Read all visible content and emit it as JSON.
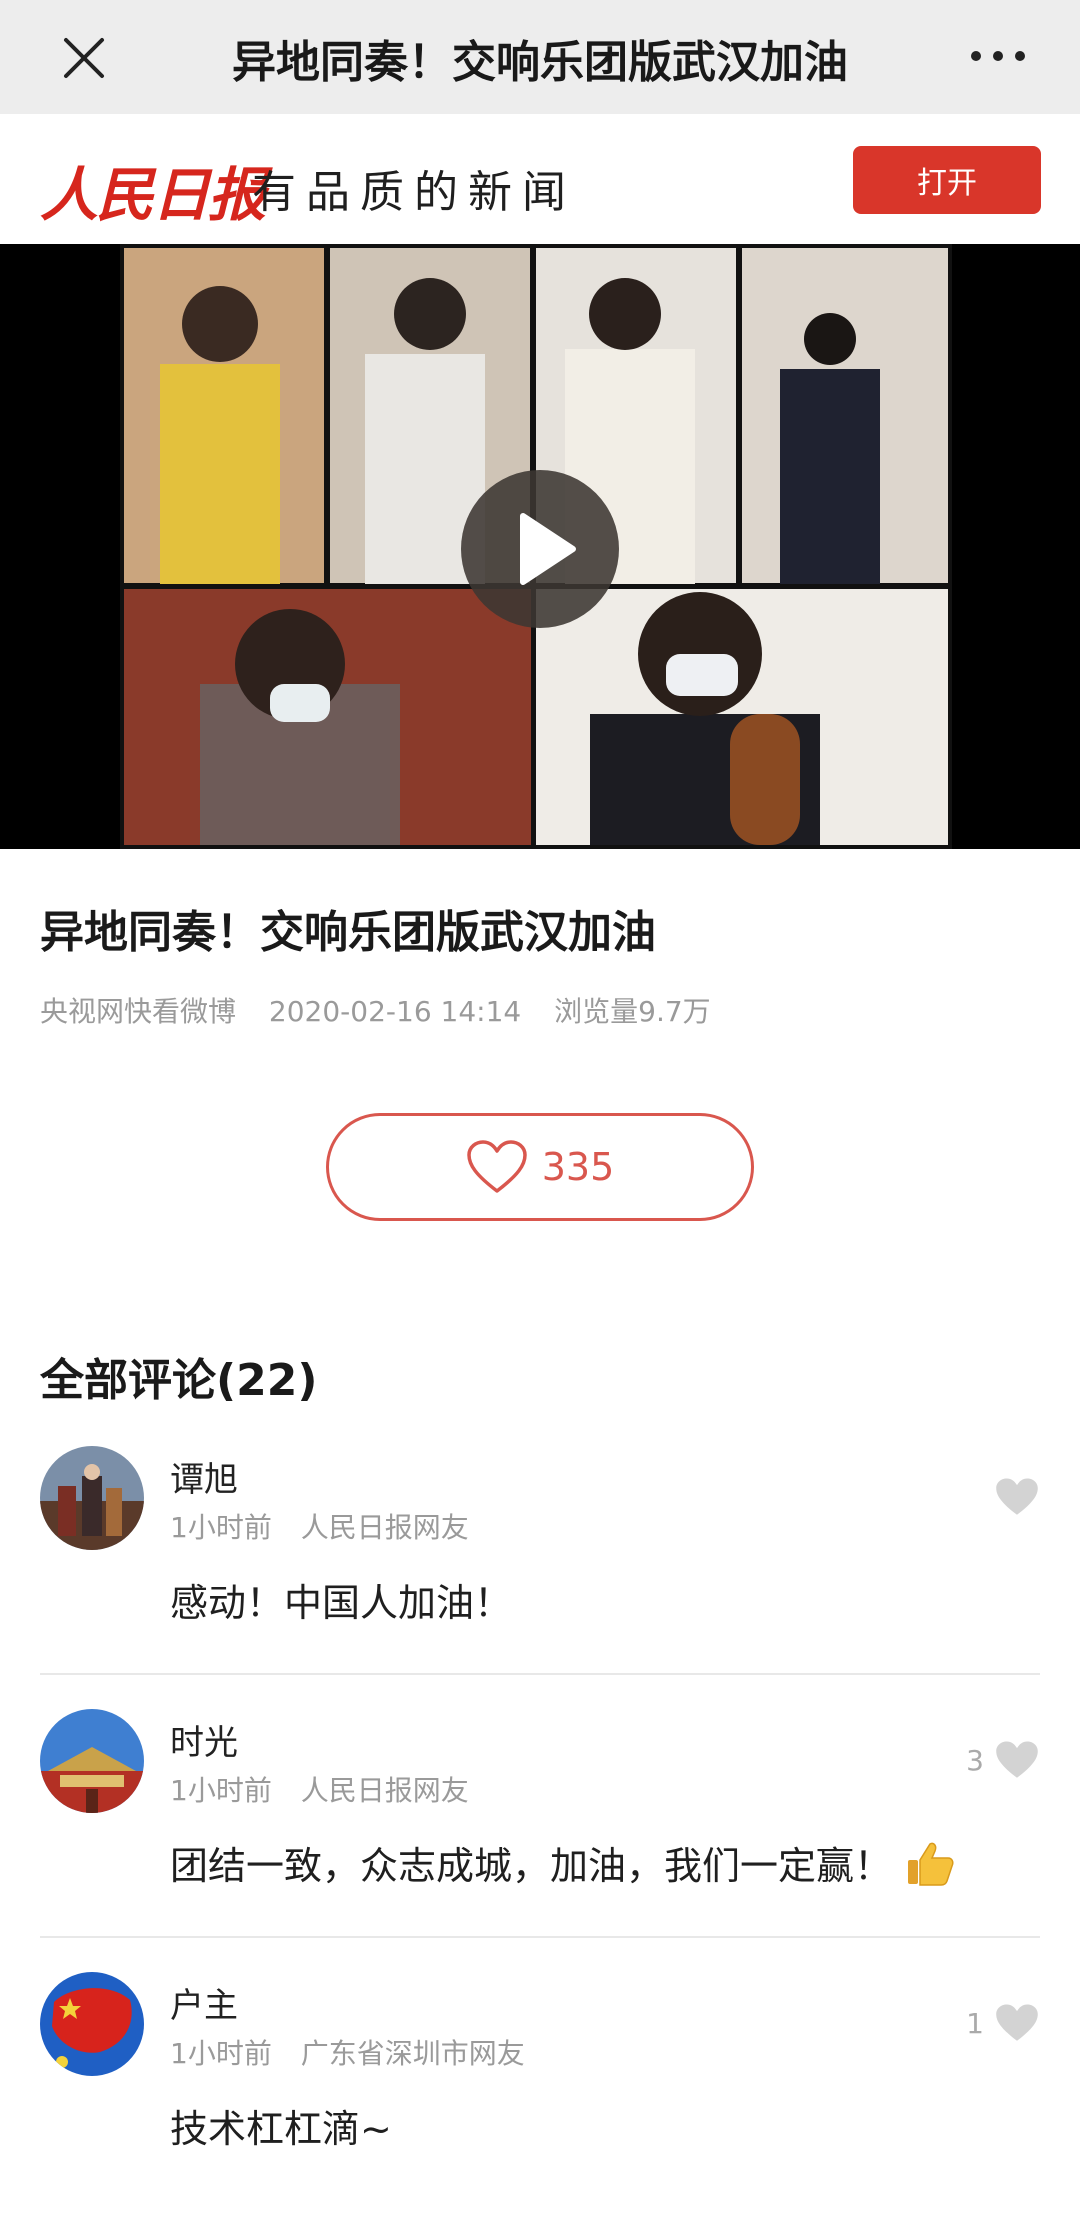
{
  "navbar": {
    "title": "异地同奏！交响乐团版武汉加油",
    "close_icon": "close-icon",
    "more_icon": "more-dots-icon"
  },
  "brand": {
    "logo": "人民日报",
    "tagline": "有品质的新闻",
    "open_label": "打开",
    "accent_color": "#d9362a"
  },
  "video": {
    "play_icon": "play-icon"
  },
  "article": {
    "title": "异地同奏！交响乐团版武汉加油",
    "source": "央视网快看微博",
    "datetime": "2020-02-16 14:14",
    "views": "浏览量9.7万",
    "likes": "335"
  },
  "comments_header": "全部评论(22)",
  "comments": [
    {
      "name": "谭旭",
      "time": "1小时前",
      "location": "人民日报网友",
      "text": "感动！中国人加油！",
      "likes": ""
    },
    {
      "name": "时光",
      "time": "1小时前",
      "location": "人民日报网友",
      "text": "团结一致，众志成城，加油，我们一定赢！",
      "likes": "3"
    },
    {
      "name": "户主",
      "time": "1小时前",
      "location": "广东省深圳市网友",
      "text": "技术杠杠滴~",
      "likes": "1"
    }
  ]
}
